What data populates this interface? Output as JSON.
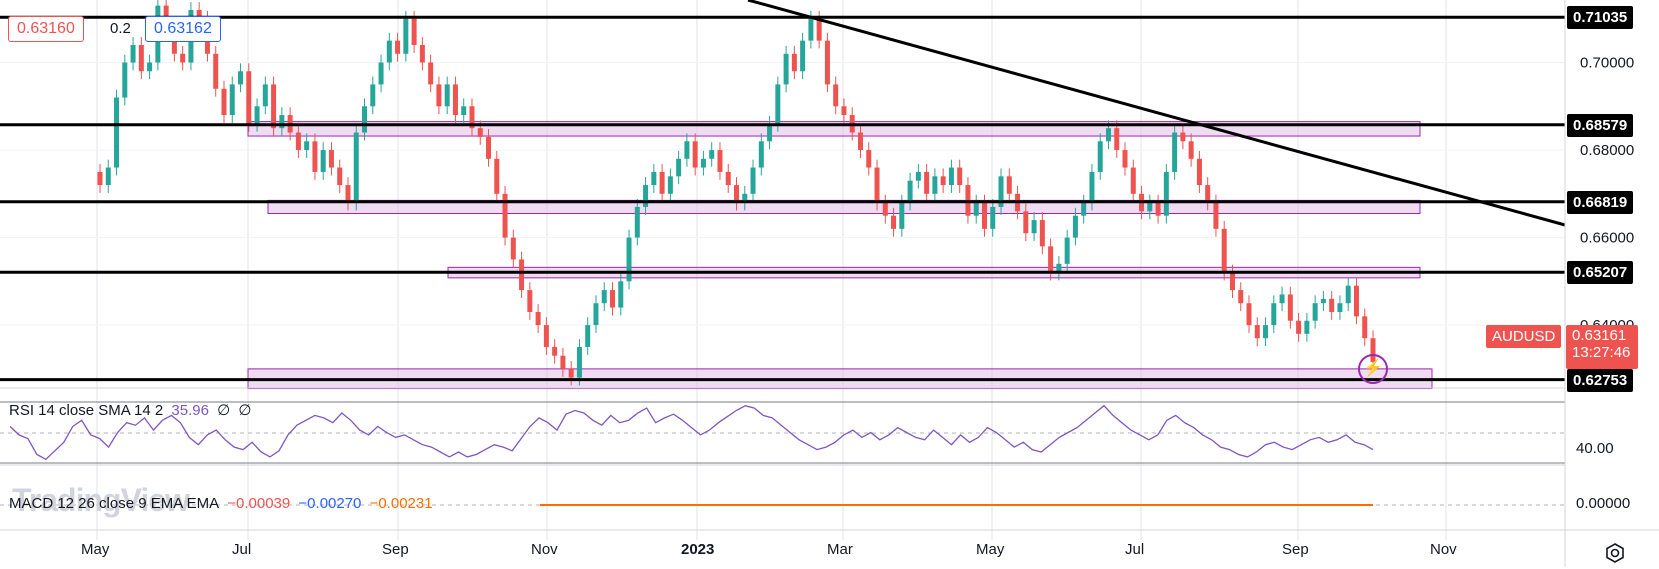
{
  "header": {
    "bid": "0.63160",
    "spread": "0.2",
    "ask": "0.63162"
  },
  "price_axis": {
    "ticks": [
      "0.70000",
      "0.68000",
      "0.66000",
      "0.64000"
    ],
    "levels": [
      {
        "label": "0.71035",
        "value": 0.71035
      },
      {
        "label": "0.68579",
        "value": 0.68579
      },
      {
        "label": "0.66819",
        "value": 0.66819
      },
      {
        "label": "0.65207",
        "value": 0.65207
      },
      {
        "label": "0.62753",
        "value": 0.62753
      }
    ],
    "symbol": "AUDUSD",
    "current_price": "0.63161",
    "countdown": "13:27:46"
  },
  "rsi": {
    "label": "RSI 14 close SMA 14 2",
    "value": "35.96",
    "extra1": "∅",
    "extra2": "∅",
    "tick": "40.00"
  },
  "macd": {
    "label": "MACD 12 26 close 9 EMA EMA",
    "v1": "−0.00039",
    "v2": "−0.00270",
    "v3": "−0.00231",
    "tick": "0.00000"
  },
  "watermark": "TradingView",
  "time_axis": [
    "May",
    "Jul",
    "Sep",
    "Nov",
    "2023",
    "Mar",
    "May",
    "Jul",
    "Sep",
    "Nov"
  ],
  "colors": {
    "up": "#26a69a",
    "down": "#ef5350",
    "zone_fill": "#e1bee7",
    "zone_stroke": "#9c27b0",
    "rsi_line": "#7e57c2",
    "macd_line": "#ff6d00",
    "level_line": "#000000"
  },
  "chart_data": {
    "type": "candlestick",
    "symbol": "AUDUSD",
    "yrange": [
      0.627,
      0.712
    ],
    "horizontal_levels": [
      0.71035,
      0.68579,
      0.66819,
      0.65207,
      0.62753
    ],
    "zones": [
      {
        "from_month": "Jul 2022",
        "to_month": "Oct 2023",
        "low": 0.6832,
        "high": 0.6865
      },
      {
        "from_month": "Jul 2022",
        "to_month": "Oct 2023",
        "low": 0.6655,
        "high": 0.6685
      },
      {
        "from_month": "Sep 2022",
        "to_month": "Oct 2023",
        "low": 0.6508,
        "high": 0.6532
      },
      {
        "from_month": "Jul 2022",
        "to_month": "Oct 2023",
        "low": 0.6255,
        "high": 0.63
      }
    ],
    "trendline": {
      "from": {
        "date": "Feb 2023",
        "price": 0.7135
      },
      "to": {
        "date": "Nov 2023",
        "price": 0.66
      }
    },
    "closes": [
      0.672,
      0.676,
      0.692,
      0.7,
      0.704,
      0.698,
      0.7,
      0.713,
      0.708,
      0.702,
      0.7,
      0.712,
      0.71,
      0.702,
      0.694,
      0.688,
      0.695,
      0.698,
      0.686,
      0.69,
      0.695,
      0.685,
      0.688,
      0.684,
      0.68,
      0.682,
      0.675,
      0.68,
      0.676,
      0.672,
      0.668,
      0.684,
      0.69,
      0.695,
      0.7,
      0.705,
      0.702,
      0.71,
      0.704,
      0.7,
      0.695,
      0.69,
      0.695,
      0.688,
      0.69,
      0.685,
      0.683,
      0.678,
      0.67,
      0.66,
      0.655,
      0.648,
      0.643,
      0.64,
      0.635,
      0.633,
      0.63,
      0.628,
      0.635,
      0.64,
      0.645,
      0.648,
      0.644,
      0.65,
      0.66,
      0.667,
      0.672,
      0.675,
      0.67,
      0.674,
      0.678,
      0.682,
      0.676,
      0.678,
      0.68,
      0.675,
      0.672,
      0.668,
      0.67,
      0.676,
      0.682,
      0.686,
      0.695,
      0.702,
      0.698,
      0.705,
      0.71,
      0.705,
      0.695,
      0.69,
      0.688,
      0.684,
      0.68,
      0.676,
      0.668,
      0.665,
      0.662,
      0.668,
      0.673,
      0.675,
      0.67,
      0.674,
      0.672,
      0.676,
      0.672,
      0.665,
      0.668,
      0.662,
      0.667,
      0.674,
      0.67,
      0.666,
      0.661,
      0.664,
      0.658,
      0.652,
      0.654,
      0.66,
      0.665,
      0.668,
      0.675,
      0.682,
      0.685,
      0.68,
      0.676,
      0.67,
      0.666,
      0.668,
      0.665,
      0.675,
      0.684,
      0.682,
      0.678,
      0.672,
      0.668,
      0.662,
      0.652,
      0.648,
      0.645,
      0.64,
      0.637,
      0.64,
      0.645,
      0.647,
      0.641,
      0.638,
      0.641,
      0.645,
      0.646,
      0.643,
      0.645,
      0.649,
      0.642,
      0.637,
      0.6316
    ],
    "rsi_values": [
      55,
      48,
      45,
      32,
      28,
      35,
      42,
      55,
      60,
      48,
      45,
      38,
      50,
      58,
      56,
      62,
      52,
      60,
      64,
      58,
      46,
      40,
      48,
      52,
      44,
      38,
      36,
      42,
      34,
      30,
      35,
      48,
      56,
      60,
      64,
      62,
      58,
      66,
      60,
      52,
      48,
      55,
      50,
      46,
      48,
      44,
      40,
      38,
      34,
      30,
      34,
      30,
      32,
      36,
      40,
      38,
      35,
      45,
      55,
      62,
      58,
      52,
      65,
      68,
      66,
      60,
      56,
      64,
      58,
      60,
      66,
      70,
      58,
      62,
      65,
      60,
      54,
      48,
      52,
      58,
      63,
      68,
      72,
      70,
      64,
      62,
      56,
      50,
      44,
      40,
      36,
      38,
      42,
      48,
      52,
      46,
      50,
      44,
      48,
      54,
      50,
      46,
      44,
      52,
      46,
      40,
      48,
      42,
      46,
      54,
      50,
      44,
      38,
      42,
      36,
      34,
      40,
      46,
      50,
      54,
      60,
      66,
      72,
      64,
      58,
      52,
      48,
      44,
      48,
      60,
      64,
      58,
      54,
      48,
      44,
      38,
      36,
      32,
      30,
      34,
      40,
      42,
      38,
      36,
      40,
      44,
      46,
      42,
      44,
      48,
      42,
      40,
      36
    ]
  }
}
